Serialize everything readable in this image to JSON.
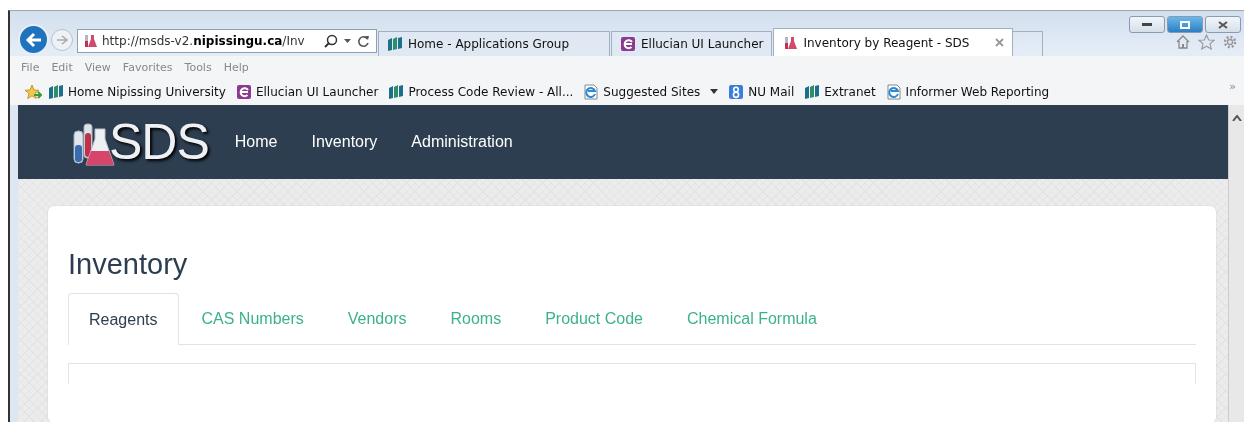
{
  "browser": {
    "address": {
      "url": "http://msds-v2.**nipissingu.ca**/Inv"
    },
    "tabs": [
      {
        "title": "Home - Applications Group",
        "kind": "nu",
        "selected": false,
        "closable": false
      },
      {
        "title": "Ellucian UI Launcher",
        "kind": "ellucian",
        "selected": false,
        "closable": false
      },
      {
        "title": "Inventory by Reagent - SDS",
        "kind": "sds",
        "selected": true,
        "closable": true
      }
    ],
    "menu": [
      "File",
      "Edit",
      "View",
      "Favorites",
      "Tools",
      "Help"
    ],
    "favorites": [
      {
        "label": "Home Nipissing University",
        "kind": "nu",
        "dropdown": false
      },
      {
        "label": "Ellucian UI Launcher",
        "kind": "ellucian",
        "dropdown": false
      },
      {
        "label": "Process Code Review - All...",
        "kind": "nu",
        "dropdown": false
      },
      {
        "label": "Suggested Sites",
        "kind": "ie",
        "dropdown": true
      },
      {
        "label": "NU Mail",
        "kind": "google",
        "dropdown": false
      },
      {
        "label": "Extranet",
        "kind": "nu",
        "dropdown": false
      },
      {
        "label": "Informer Web Reporting",
        "kind": "ie",
        "dropdown": false
      }
    ],
    "overflow": "»"
  },
  "page": {
    "brand": "SDS",
    "nav": [
      "Home",
      "Inventory",
      "Administration"
    ],
    "heading": "Inventory",
    "tabs": [
      {
        "label": "Reagents",
        "selected": true
      },
      {
        "label": "CAS Numbers",
        "selected": false
      },
      {
        "label": "Vendors",
        "selected": false
      },
      {
        "label": "Rooms",
        "selected": false
      },
      {
        "label": "Product Code",
        "selected": false
      },
      {
        "label": "Chemical Formula",
        "selected": false
      }
    ]
  }
}
